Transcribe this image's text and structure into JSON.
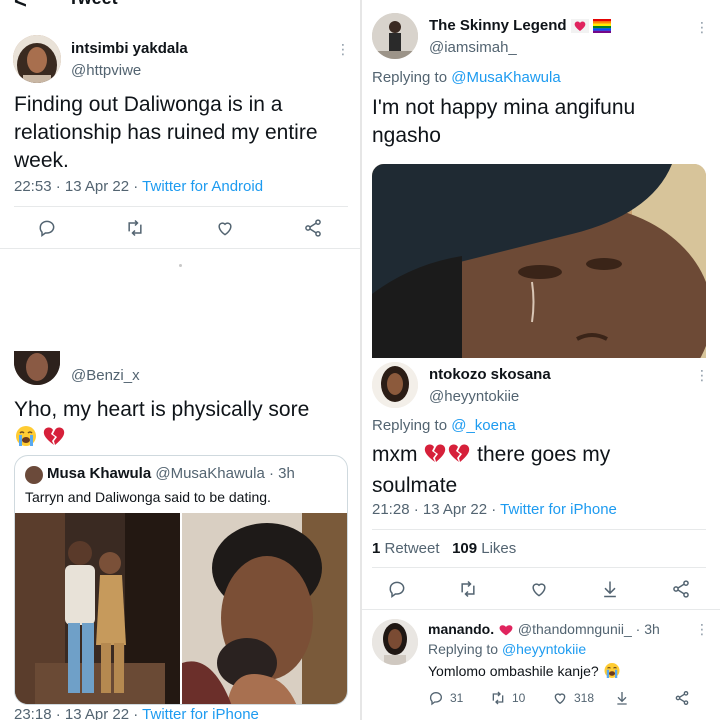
{
  "left": {
    "header": {
      "back_glyph": "<",
      "title": "Tweet"
    },
    "tweet1": {
      "name": "intsimbi yakdala",
      "handle": "@httpviwe",
      "text": "Finding out Daliwonga is in a relationship has ruined my entire week.",
      "time": "22:53 · 13 Apr 22 · ",
      "source": "Twitter for Android"
    },
    "tweet2": {
      "handle": "@Benzi_x",
      "text": "Yho, my heart is physically sore",
      "quote": {
        "name": "Musa Khawula",
        "handle_time": "@MusaKhawula · 3h",
        "text": "Tarryn and Daliwonga said to be dating."
      },
      "time": "23:18 · 13 Apr 22 · ",
      "source": "Twitter for iPhone"
    }
  },
  "right": {
    "tweet1": {
      "name": "The Skinny Legend",
      "handle": "@iamsimah_",
      "replying_prefix": "Replying to ",
      "replying_to": "@MusaKhawula",
      "text": "I'm not happy mina angifunu ngasho"
    },
    "tweet2": {
      "name": "ntokozo skosana",
      "handle": "@heyyntokiie",
      "replying_prefix": "Replying to ",
      "replying_to": "@_koena",
      "text_a": "mxm ",
      "text_b": " there goes my soulmate",
      "time": "21:28 · 13 Apr 22 · ",
      "source": "Twitter for iPhone",
      "retweets_count": "1",
      "retweets_label": " Retweet",
      "likes_count": "109",
      "likes_label": " Likes"
    },
    "tweet3": {
      "name": "manando.",
      "handle_time": "@thandomngunii_ · 3h",
      "replying_prefix": "Replying to ",
      "replying_to": "@heyyntokiie",
      "text": "Yomlomo ombashile kanje?",
      "replies": "31",
      "retweets": "10",
      "likes": "318"
    }
  },
  "icons": [
    "back-arrow-icon",
    "more-icon",
    "reply-icon",
    "retweet-icon",
    "like-icon",
    "share-icon",
    "download-icon",
    "broken-heart-emoji",
    "crying-face-emoji",
    "heart-emoji",
    "rainbow-flag-emoji"
  ],
  "colors": {
    "link": "#1d9bf0",
    "secondary": "#536471",
    "divider": "#e7e9ea",
    "broken_heart": "#d6203a"
  }
}
